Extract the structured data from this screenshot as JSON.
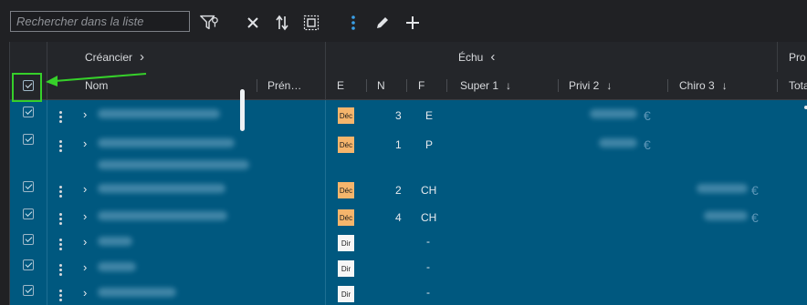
{
  "search": {
    "placeholder": "Rechercher dans la liste"
  },
  "toolbar": {
    "icons": [
      "filter-icon",
      "close-icon",
      "sort-icon",
      "select-all-icon",
      "kebab-icon",
      "pencil-icon",
      "plus-icon"
    ]
  },
  "header_groups": {
    "creancier": "Créancier",
    "creancier_toggle": "›",
    "echu": "Échu",
    "echu_toggle": "‹",
    "pro": "Pro"
  },
  "columns": {
    "nom": "Nom",
    "prenom": "Prén…",
    "e": "E",
    "n": "N",
    "f": "F",
    "super1": "Super 1",
    "privi2": "Privi 2",
    "chiro3": "Chiro 3",
    "total": "Tota",
    "sort_arrow": "↓"
  },
  "colors": {
    "background": "#202124",
    "row_selected": "#00587f",
    "badge_dec": "#f5b56c",
    "badge_dir": "#f6f6f6",
    "highlight": "#36d02a"
  },
  "rows": [
    {
      "badge": "Déc",
      "type": "dec",
      "num": "3",
      "code": "E",
      "euro_col": "privi"
    },
    {
      "badge": "Déc",
      "type": "dec",
      "num": "1",
      "code": "P",
      "euro_col": "privi"
    },
    {
      "badge": "Déc",
      "type": "dec",
      "num": "2",
      "code": "CH",
      "euro_col": "chiro"
    },
    {
      "badge": "Déc",
      "type": "dec",
      "num": "4",
      "code": "CH",
      "euro_col": "chiro"
    },
    {
      "badge": "Dir",
      "type": "dir",
      "num": "",
      "code": "-",
      "euro_col": ""
    },
    {
      "badge": "Dir",
      "type": "dir",
      "num": "",
      "code": "-",
      "euro_col": ""
    },
    {
      "badge": "Dir",
      "type": "dir",
      "num": "",
      "code": "-",
      "euro_col": ""
    }
  ],
  "euro_symbol": "€"
}
